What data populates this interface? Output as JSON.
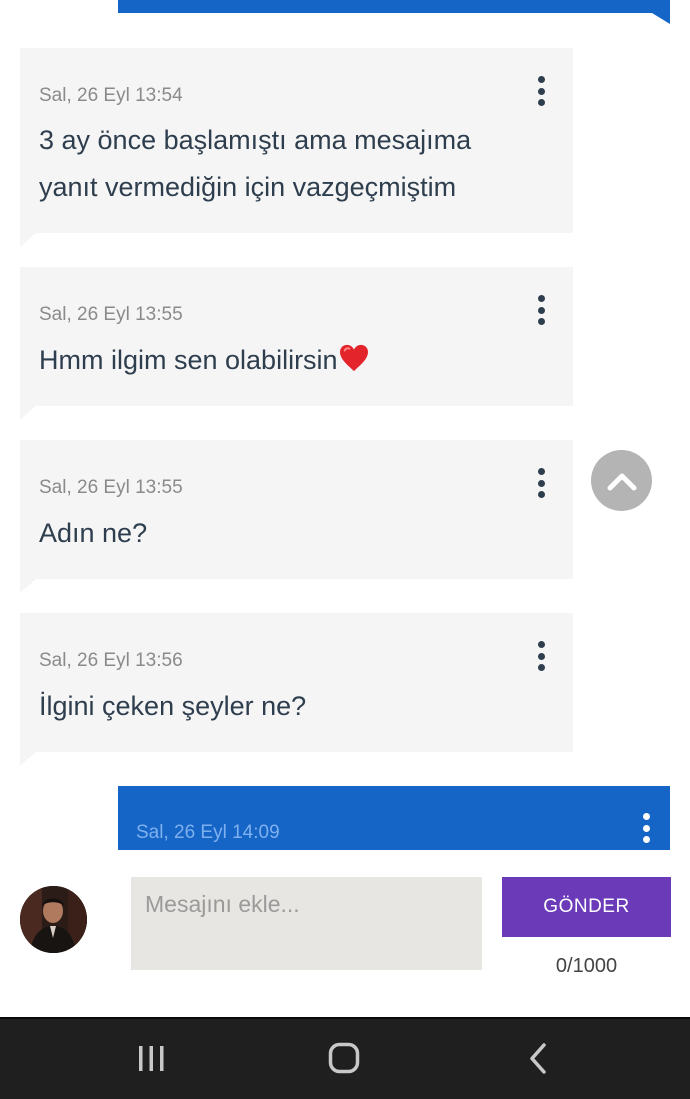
{
  "messages": [
    {
      "timestamp": "Sal, 26 Eyl 13:54",
      "line1": "3 ay önce başlamıştı ama mesajıma",
      "line2": "yanıt vermediğin için vazgeçmiştim"
    },
    {
      "timestamp": "Sal, 26 Eyl 13:55",
      "text": "Hmm ilgim sen olabilirsin",
      "emoji": "red-heart"
    },
    {
      "timestamp": "Sal, 26 Eyl 13:55",
      "text": "Adın ne?"
    },
    {
      "timestamp": "Sal, 26 Eyl 13:56",
      "text": "İlgini çeken şeyler ne?"
    }
  ],
  "sent_message": {
    "timestamp": "Sal, 26 Eyl 14:09"
  },
  "composer": {
    "placeholder": "Mesajını ekle...",
    "value": "",
    "send_label": "GÖNDER",
    "char_count": "0/1000"
  },
  "icons": {
    "menu": "more-vert-icon",
    "scroll_up": "chevron-up-icon",
    "nav": [
      "recent-apps-icon",
      "home-icon",
      "back-icon"
    ]
  },
  "colors": {
    "sent_bubble": "#1565c7",
    "received_bubble": "#f5f5f5",
    "send_button": "#6a3ab8",
    "scroll_button": "#b4b4b4",
    "nav_bar": "#1f1f1f"
  }
}
